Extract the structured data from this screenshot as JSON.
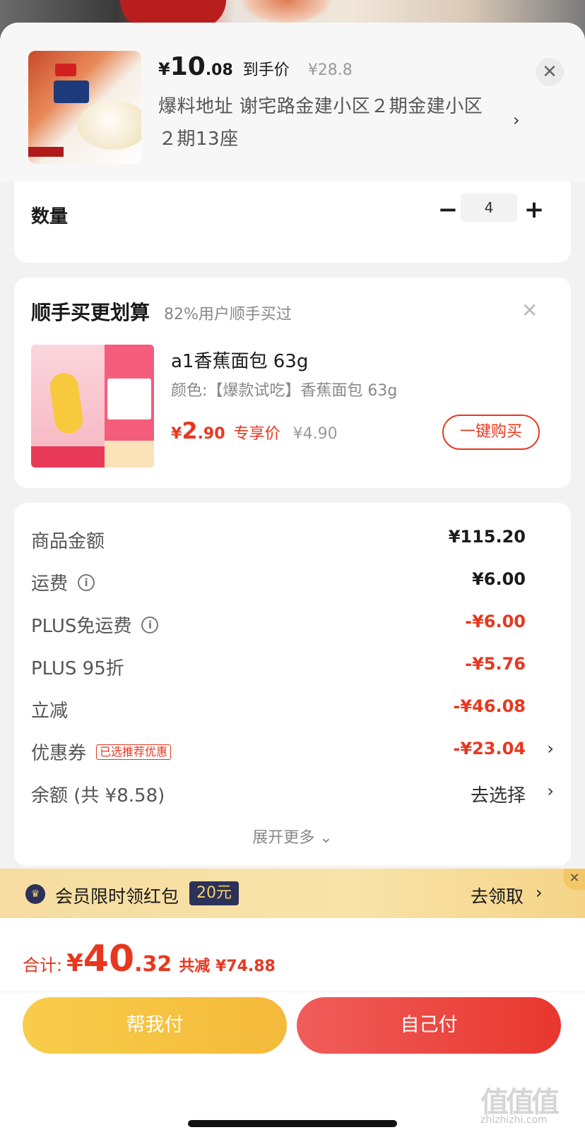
{
  "header": {
    "price_currency": "¥",
    "price_int": "10",
    "price_dec": ".08",
    "price_label": "到手价",
    "orig_price": "¥28.8",
    "address": "爆料地址  谢宅路金建小区２期金建小区２期13座",
    "arrow": "›",
    "close": "✕"
  },
  "quantity": {
    "label": "数量",
    "minus": "−",
    "value": "4",
    "plus": "+"
  },
  "upsell": {
    "title": "顺手买更划算",
    "subtitle": "82%用户顺手买过",
    "close": "✕",
    "product_name": "a1香蕉面包 63g",
    "spec": "颜色:【爆款试吃】香蕉面包 63g",
    "price_currency": "¥",
    "price_int": "2",
    "price_dec": ".90",
    "price_label": "专享价",
    "orig_price": "¥4.90",
    "buy_button": "一键购买"
  },
  "summary": {
    "rows": [
      {
        "label": "商品金额",
        "value": "¥115.20"
      },
      {
        "label": "运费",
        "value": "¥6.00"
      },
      {
        "label": "PLUS免运费",
        "value": "-¥6.00"
      },
      {
        "label": "PLUS 95折",
        "value": "-¥5.76"
      },
      {
        "label": "立减",
        "value": "-¥46.08"
      },
      {
        "label": "优惠券",
        "badge": "已选推荐优惠",
        "value": "-¥23.04",
        "arrow": "›"
      },
      {
        "label": "余额 (共 ¥8.58)",
        "value": "去选择",
        "arrow": "›"
      }
    ],
    "info_icon": "i",
    "expand": "展开更多 ⌄"
  },
  "promo": {
    "crown": "♛",
    "text": "会员限时领红包",
    "amount": "20元",
    "action": "去领取",
    "arrow": "›",
    "close": "✕"
  },
  "bottom": {
    "total_label": "合计:",
    "total_currency": "¥",
    "total_int": "40",
    "total_dec": ".32",
    "total_saved": "共减 ¥74.88",
    "help_button": "帮我付",
    "self_button": "自己付"
  },
  "watermark": {
    "logo": "值值值",
    "url": "zhizhizhi.com"
  },
  "colors": {
    "accent_red": "#e8371f",
    "help_yellow": "#f6c543",
    "promo_navy": "#2b3158"
  }
}
